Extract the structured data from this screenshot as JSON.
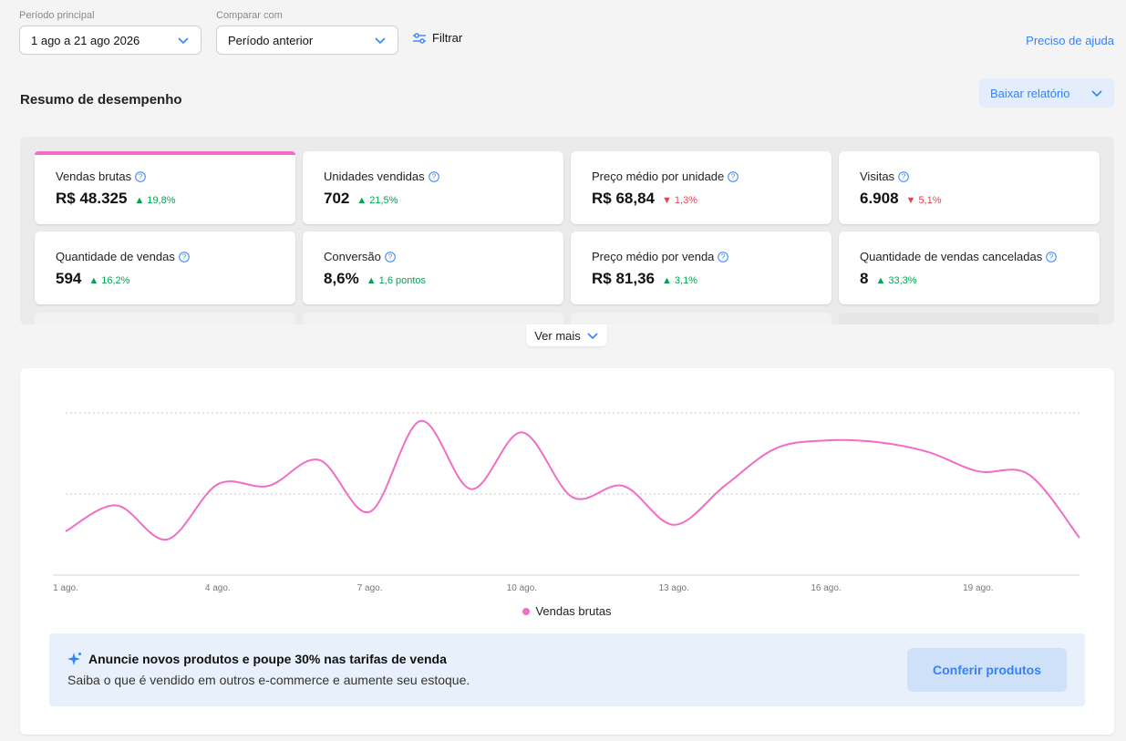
{
  "filters": {
    "main_period_label": "Período principal",
    "main_period_value": "1 ago a 21 ago 2026",
    "compare_label": "Comparar com",
    "compare_value": "Período anterior",
    "filter_label": "Filtrar"
  },
  "help_link": "Preciso de ajuda",
  "summary": {
    "title": "Resumo de desempenho",
    "download_label": "Baixar relatório",
    "see_more_label": "Ver mais"
  },
  "metrics": [
    {
      "title": "Vendas brutas",
      "value": "R$ 48.325",
      "delta": "19,8%",
      "trend": "up"
    },
    {
      "title": "Unidades vendidas",
      "value": "702",
      "delta": "21,5%",
      "trend": "up"
    },
    {
      "title": "Preço médio por unidade",
      "value": "R$ 68,84",
      "delta": "1,3%",
      "trend": "down"
    },
    {
      "title": "Visitas",
      "value": "6.908",
      "delta": "5,1%",
      "trend": "down"
    },
    {
      "title": "Quantidade de vendas",
      "value": "594",
      "delta": "16,2%",
      "trend": "up"
    },
    {
      "title": "Conversão",
      "value": "8,6%",
      "delta": "1,6 pontos",
      "trend": "up"
    },
    {
      "title": "Preço médio por venda",
      "value": "R$ 81,36",
      "delta": "3,1%",
      "trend": "up"
    },
    {
      "title": "Quantidade de vendas canceladas",
      "value": "8",
      "delta": "33,3%",
      "trend": "up"
    }
  ],
  "colors": {
    "accent": "#3483fa",
    "series": "#f06ec3",
    "up": "#00a650",
    "down": "#f23d4f"
  },
  "chart_data": {
    "type": "line",
    "x": [
      "1 ago.",
      "2 ago.",
      "3 ago.",
      "4 ago.",
      "5 ago.",
      "6 ago.",
      "7 ago.",
      "8 ago.",
      "9 ago.",
      "10 ago.",
      "11 ago.",
      "12 ago.",
      "13 ago.",
      "14 ago.",
      "15 ago.",
      "16 ago.",
      "17 ago.",
      "18 ago.",
      "19 ago.",
      "20 ago.",
      "21 ago."
    ],
    "x_tick_labels": [
      "1 ago.",
      "4 ago.",
      "7 ago.",
      "10 ago.",
      "13 ago.",
      "16 ago.",
      "19 ago."
    ],
    "series": [
      {
        "name": "Vendas brutas",
        "values": [
          0.27,
          0.43,
          0.22,
          0.56,
          0.55,
          0.71,
          0.39,
          0.95,
          0.53,
          0.88,
          0.48,
          0.55,
          0.31,
          0.55,
          0.78,
          0.83,
          0.82,
          0.76,
          0.64,
          0.62,
          0.23
        ]
      }
    ],
    "ylim": [
      0,
      1.0
    ],
    "gridlines": [
      0.5,
      1.0
    ],
    "grid": true,
    "legend": "bottom-center"
  },
  "promo": {
    "title_prefix": "Anuncie novos produtos e poupe ",
    "title_highlight": "30%",
    "title_suffix": " nas tarifas de venda",
    "subtitle": "Saiba o que é vendido em outros e-commerce e aumente seu estoque.",
    "button": "Conferir produtos"
  }
}
